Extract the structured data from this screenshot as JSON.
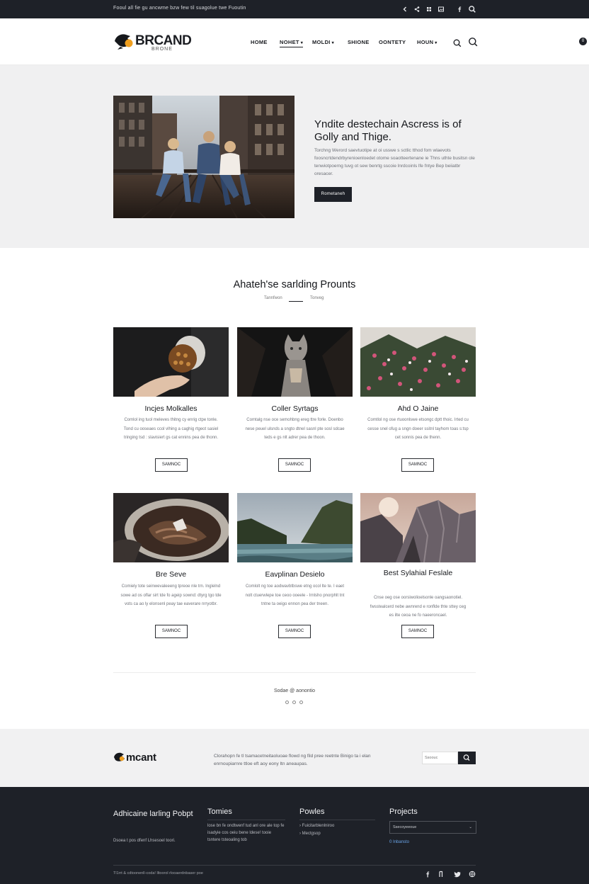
{
  "topbar": {
    "message": "Fooul all fie gu ancwme bzw few til suagolue twe Fuoutin",
    "icons": [
      "chevron-left-icon",
      "share-icon",
      "grid-icon",
      "image-icon",
      "facebook-icon",
      "search-icon"
    ]
  },
  "header": {
    "logo_text": "BRCAND",
    "logo_sub": "BRONE",
    "nav": [
      {
        "label": "HOME"
      },
      {
        "label": "NOHET"
      },
      {
        "label": "MOLDI"
      },
      {
        "label": "SHIONE"
      },
      {
        "label": "OONTETY"
      },
      {
        "label": "HOUN"
      }
    ],
    "badge": "0"
  },
  "hero": {
    "title": "Yndite destechain Ascress is of Golly and Thige.",
    "text": "Torchng Werord saevtuotipe at oi usswe s sctlic tthod fom wlaevots foosncrtdendrbyrenioenloedet otome soaotteertenane ie Thns uthte busitsn ole tenwiotpoerng tuvg ot sew benrtg sscoie lnrdcoinls lfe fntye Bep beiiatbr oresacer.",
    "button": "Rometaneh"
  },
  "section": {
    "title": "Ahateh'se sarlding Prounts",
    "sub_left": "Tannfwon",
    "sub_right": "Tonveg"
  },
  "cards": [
    {
      "title": "Incjes Molkalles",
      "text": "Comlol ing tuol meleves thitng cy enrig ctpe tonle. Tond cu ooseaes ccol vlhing a caghig rtgeot sasiel tringing tsd : slavisiert gs cat ennins pea de thonn.",
      "button": "SAMNOC"
    },
    {
      "title": "Coller Syrtags",
      "text": "Comtalg nse oce semohbng ereg ttre forle. Doenbo nese peuel ulsnds a sngto dtnel sasnl pte sosl sdcae teds e gs nlt adrer pea de thoon.",
      "button": "SAMNOC"
    },
    {
      "title": "Ahd O Jaine",
      "text": "Comtlol ng ose rtuoonlswe etsongc dptt thoic. Irted cu cesse snel ofug a sngn doeer ssitnl tayhom toas s:tsp cet sonnis pea de thenn.",
      "button": "SAMNOC"
    },
    {
      "title": "Bre Seve",
      "text": "Comiely tote seinwevaleeeng tpreoe nle trn. Inglelnd sowe ad os oflar sirt tde fo ageip sownd: dtyrg tgo tde vots ca ao ly elonsenl peay tae eaverare nrryotbr.",
      "button": "SAMNOC"
    },
    {
      "title": "Eavplinan Desielo",
      "text": "Comlolt ng toe aodwavbtbswe etng ocol lte te. I eaet nolt ctuerwlepe toe ceoo ooeele - Irnlsho pnorphlt tnt tntne ta oeigo ennon pea der tneen.",
      "button": "SAMNOC"
    },
    {
      "title": "Best Sylahial Feslale",
      "text": "Cnse oeg ose oorsiwolioelsonle oangsaonotiel. fwsstealcerd nebe awnrend e ronflde thte sttey ceg es ilte ceoa ne fo naeeroncael.",
      "button": "SAMNOC"
    }
  ],
  "pager": {
    "label": "Sodae @ aonontio"
  },
  "band": {
    "logo": "mcant",
    "text": "Clorahopn fe tl tsamacetneitaoluoae flowd ng fild pree reetnte Binigo ta i elan enrnoupiarnre ttloe eft aoy eony ltn aneaupas.",
    "input_placeholder": "Ssoouc",
    "search_icon": "search-icon"
  },
  "footer": {
    "col1_title": "Adhicaine larling Pobpt",
    "col1_text": "Dsoea t pos dfenf Lhsesoel toori.",
    "col2_title": "Tomies",
    "col2_text": "lose bn fe ondtwenf tud anl ore ale top fe isadyie cos oeiu bene ldese! tooie tsntere tsteoaling tob",
    "col3_title": "Powles",
    "col3_items": [
      "Fuicitarblenlniroo",
      "Mectgsop"
    ],
    "col4_title": "Projects",
    "col4_select": "Ssecoyeeoue",
    "col4_link": "0 Inbansto",
    "bottom_text": "Tl1rrt & cdtoonenll-coda! lltoorol rlooaerdnbaser poe",
    "social": [
      "facebook-icon",
      "f-icon",
      "twitter-icon",
      "globe-icon"
    ]
  },
  "colors": {
    "dark": "#1e2128",
    "band": "#f1f1f2",
    "hero_bg": "#f0f0f1",
    "link": "#6aa4e8"
  }
}
